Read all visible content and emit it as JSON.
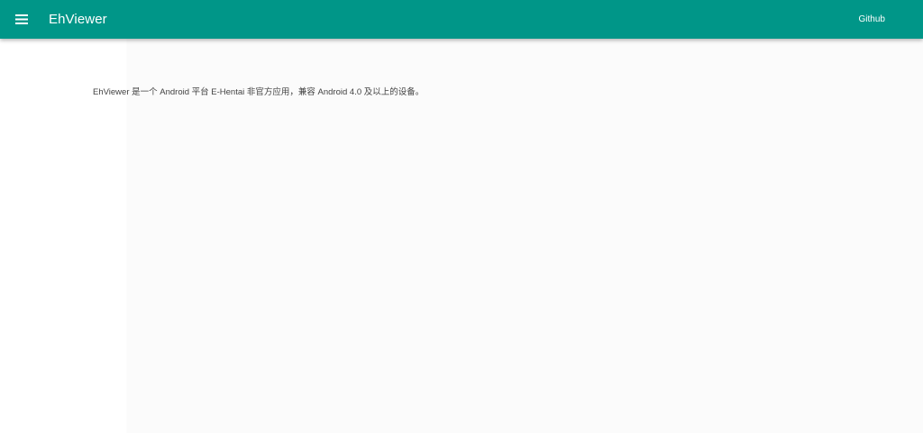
{
  "app_bar": {
    "menu_icon": "menu-icon",
    "title": "EhViewer",
    "github_link": "Github",
    "color": "#009688"
  },
  "main": {
    "description": "EhViewer 是一个 Android 平台 E-Hentai 非官方应用，兼容 Android 4.0 及以上的设备。"
  }
}
